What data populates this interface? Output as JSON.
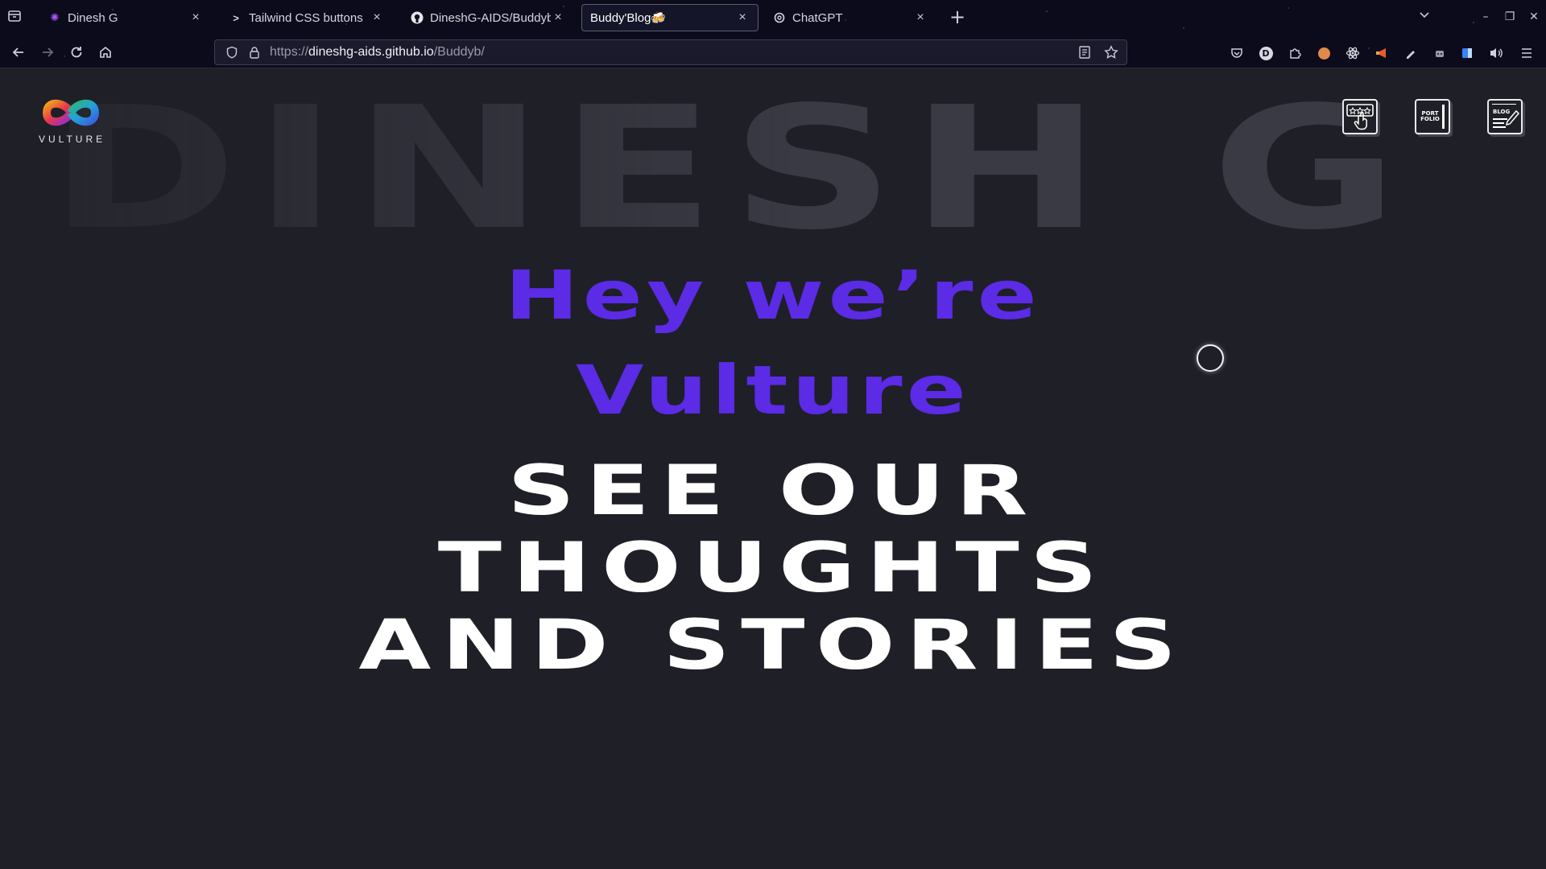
{
  "browser": {
    "tabs": [
      {
        "title": "Dinesh G",
        "icon": "brain-icon",
        "active": false
      },
      {
        "title": "Tailwind CSS buttons",
        "icon": "terminal-prompt-icon",
        "active": false
      },
      {
        "title": "DineshG-AIDS/Buddyb",
        "icon": "github-icon",
        "active": false
      },
      {
        "title": "Buddy'Blog🍻",
        "icon": "none",
        "active": true
      },
      {
        "title": "ChatGPT",
        "icon": "openai-icon",
        "active": false
      }
    ],
    "url": {
      "scheme": "https://",
      "host": "dineshg-aids.github.io",
      "path": "/Buddyb/"
    },
    "colors": {
      "chrome_bg": "#0c0b1b",
      "active_tab_border": "#5c5c6e"
    }
  },
  "page": {
    "background_word": "DINESH G",
    "logo": {
      "text": "VULTURE",
      "icon": "infinity-logo-icon"
    },
    "nav_icons": [
      {
        "name": "rating-hand-icon",
        "label": ""
      },
      {
        "name": "portfolio-icon",
        "label": "PORT FOLIO"
      },
      {
        "name": "blog-icon",
        "label": "BLOG"
      }
    ],
    "hero": {
      "line1": "Hey we’re",
      "line2": "Vulture",
      "headline": [
        "SEE OUR",
        "THOUGHTS",
        "AND STORIES"
      ]
    },
    "colors": {
      "accent": "#5b2be6",
      "page_bg": "#1f1f27",
      "headline": "#ffffff"
    }
  }
}
